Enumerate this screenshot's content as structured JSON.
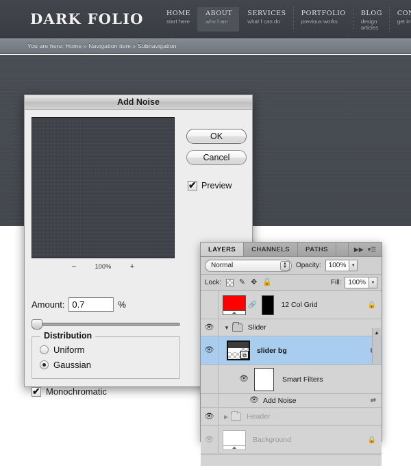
{
  "site": {
    "logo": "DARK FOLIO",
    "nav": [
      {
        "title": "HOME",
        "subtitle": "start here",
        "active": false
      },
      {
        "title": "ABOUT",
        "subtitle": "who I am",
        "active": true
      },
      {
        "title": "SERVICES",
        "subtitle": "what I can do",
        "active": false
      },
      {
        "title": "PORTFOLIO",
        "subtitle": "previous works",
        "active": false
      },
      {
        "title": "BLOG",
        "subtitle": "design articles",
        "active": false
      },
      {
        "title": "CONTACT",
        "subtitle": "get in touch",
        "active": false
      }
    ],
    "breadcrumb": "You are here: Home » Navigation item » Subnavigation"
  },
  "dialog": {
    "title": "Add Noise",
    "zoom": {
      "minus": "–",
      "value": "100%",
      "plus": "+"
    },
    "amount": {
      "label": "Amount:",
      "value": "0.7",
      "unit": "%"
    },
    "distribution": {
      "legend": "Distribution",
      "options": [
        {
          "label": "Uniform",
          "checked": false
        },
        {
          "label": "Gaussian",
          "checked": true
        }
      ]
    },
    "monochromatic": {
      "label": "Monochromatic",
      "checked": true
    },
    "buttons": {
      "ok": "OK",
      "cancel": "Cancel"
    },
    "preview": {
      "label": "Preview",
      "checked": true
    }
  },
  "layers_panel": {
    "tabs": [
      {
        "label": "LAYERS",
        "active": true
      },
      {
        "label": "CHANNELS",
        "active": false
      },
      {
        "label": "PATHS",
        "active": false
      }
    ],
    "collapse_icon": "▶▶",
    "menu_icon": "▾☰",
    "blend_mode": "Normal",
    "opacity": {
      "label": "Opacity:",
      "value": "100%"
    },
    "lock": {
      "label": "Lock:",
      "icons": [
        "transparent-pixels-icon",
        "brush-icon",
        "move-icon",
        "lock-all-icon"
      ]
    },
    "fill": {
      "label": "Fill:",
      "value": "100%"
    },
    "layers": [
      {
        "name": "12 Col Grid",
        "visible": false,
        "selected": false,
        "locked": true,
        "thumb": "red-with-mask",
        "indent": 0
      },
      {
        "name": "Slider",
        "visible": true,
        "selected": false,
        "locked": false,
        "thumb": "folder-open",
        "indent": 0
      },
      {
        "name": "slider bg",
        "visible": true,
        "selected": true,
        "locked": false,
        "thumb": "smart-object",
        "indent": 1
      },
      {
        "name": "Smart Filters",
        "visible": true,
        "selected": false,
        "locked": false,
        "thumb": "filter-mask",
        "indent": 2
      },
      {
        "name": "Add Noise",
        "visible": true,
        "selected": false,
        "locked": false,
        "thumb": "none",
        "indent": 3
      },
      {
        "name": "Header",
        "visible": true,
        "selected": false,
        "locked": false,
        "thumb": "folder-closed",
        "indent": 0
      },
      {
        "name": "Background",
        "visible": true,
        "selected": false,
        "locked": true,
        "thumb": "white",
        "indent": 0
      }
    ]
  }
}
